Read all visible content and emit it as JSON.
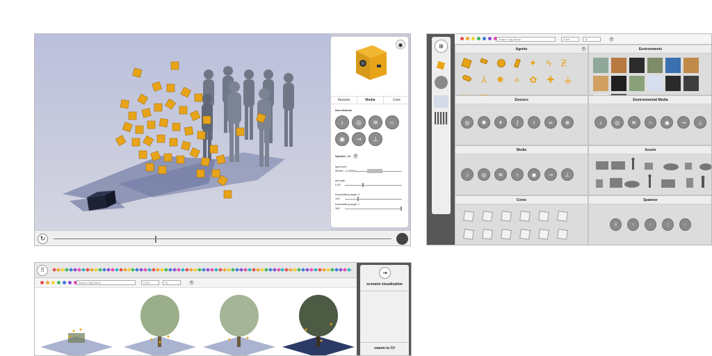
{
  "viewer": {
    "tabs": [
      "Sensors",
      "Media",
      "Core"
    ],
    "new_medium_label": "New Medium",
    "speaker_label": "Speaker_01",
    "params": [
      {
        "name": "spectrum",
        "value": "300Hz - 2,000Hz"
      },
      {
        "name": "strength",
        "value": "0.40"
      },
      {
        "name": "transmitting angle X",
        "value": "120"
      },
      {
        "name": "transmitting angle Y",
        "value": "360"
      }
    ],
    "timeline_progress": 0.3,
    "media_icons": [
      "speaker-icon",
      "sound-wave-icon",
      "heat-icon",
      "magnet-icon",
      "radar-icon",
      "emitter-icon",
      "sprinkler-icon"
    ]
  },
  "library": {
    "search_placeholder": "Search Tag Name",
    "from_placeholder": "From",
    "to_placeholder": "To",
    "filter_colors": [
      "#e84a4a",
      "#f2a531",
      "#f2d531",
      "#3cba5c",
      "#3a7bdc",
      "#8a4ad8",
      "#e84ab8"
    ],
    "sections": {
      "agents": "Agents",
      "environments": "Environments",
      "sensors": "Sensors",
      "environmental_media": "Environmental Media",
      "media": "Media",
      "assets": "Assets",
      "cores": "Cores",
      "spawner": "Spawner"
    },
    "environment_swatches": [
      "#8fa89a",
      "#b7793f",
      "#2b2b2b",
      "#7e8c6a",
      "#3a6fb0",
      "#c08a4a",
      "#d0a060",
      "#202020",
      "#8aa07a",
      "#d7def0",
      "#2a2a2a",
      "#3e3e3e",
      "#e6e6e6",
      "#555555"
    ]
  },
  "scenario": {
    "search_placeholder": "Search Tag Name",
    "from_placeholder": "From",
    "to_placeholder": "To",
    "visualization_label": "scenario visualization",
    "swarm_label": "swarm to C#",
    "timeline_colors": [
      "#e84a4a",
      "#f2a531",
      "#f2d531",
      "#3cba5c",
      "#3a7bdc",
      "#8a4ad8",
      "#e84ab8",
      "#29b6c8"
    ]
  }
}
